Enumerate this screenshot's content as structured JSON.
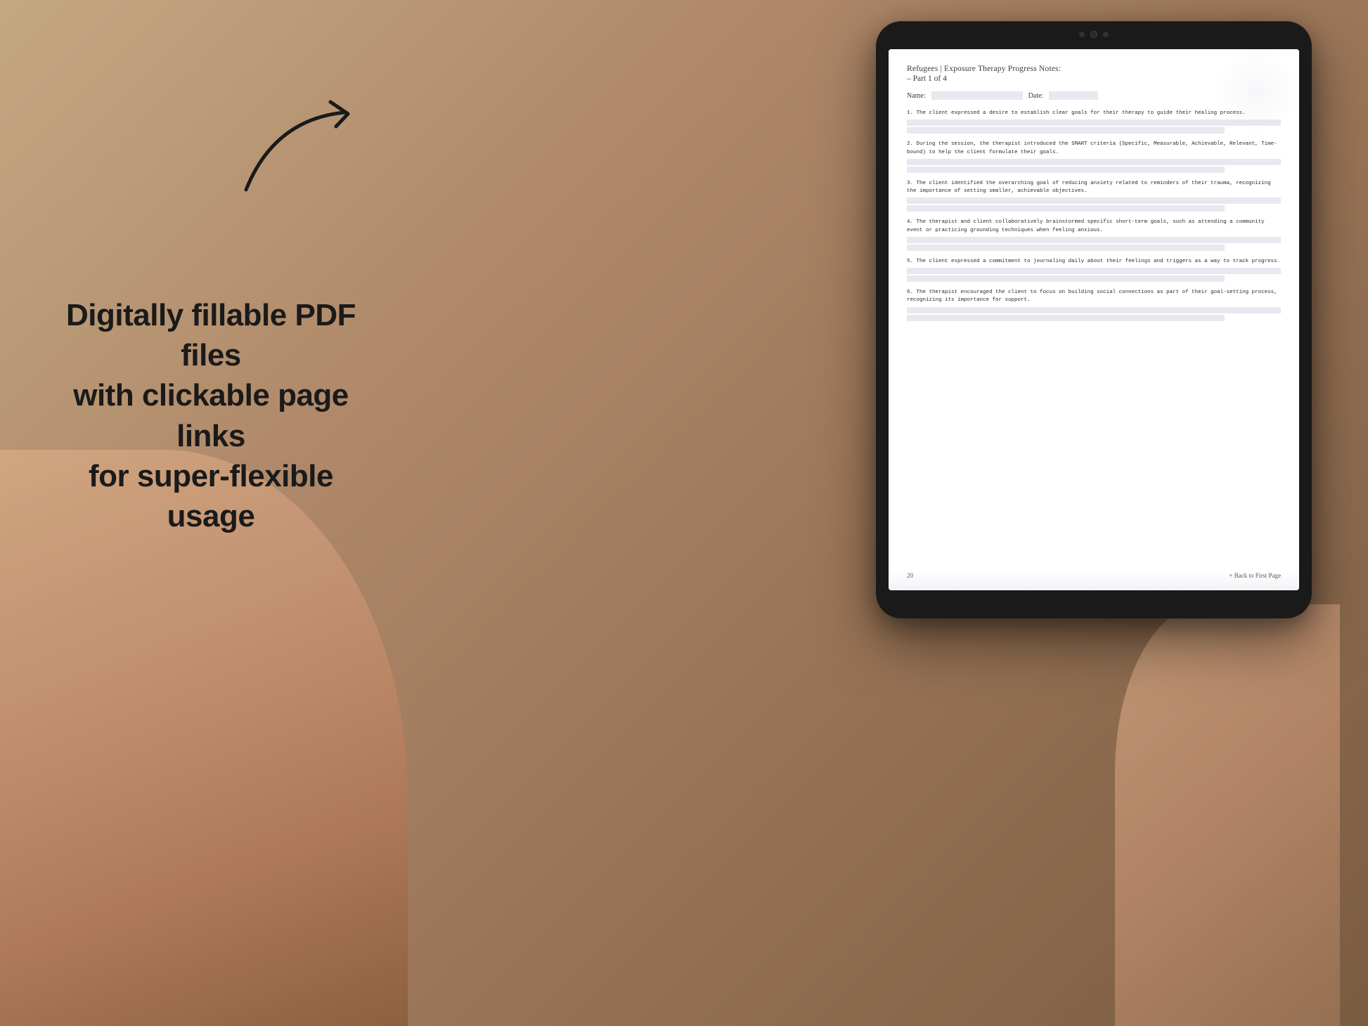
{
  "background": {
    "color": "#b5967a"
  },
  "left_text": {
    "line1": "Digitally fillable PDF files",
    "line2": "with clickable page links",
    "line3": "for super-flexible usage"
  },
  "arrow": {
    "description": "curved arrow pointing right toward tablet"
  },
  "tablet": {
    "title": "Refugees | Exposure Therapy Progress Notes:",
    "subtitle": "– Part 1 of 4",
    "fields": {
      "name_label": "Name:",
      "date_label": "Date:"
    },
    "items": [
      {
        "number": "1.",
        "text": "The client expressed a desire to establish clear goals for their therapy to guide their\nhealing process."
      },
      {
        "number": "2.",
        "text": "During the session, the therapist introduced the SMART criteria (Specific, Measurable,\nAchievable, Relevant, Time-bound) to help the client formulate their goals."
      },
      {
        "number": "3.",
        "text": "The client identified the overarching goal of reducing anxiety related to reminders of\ntheir trauma, recognizing the importance of setting smaller, achievable objectives."
      },
      {
        "number": "4.",
        "text": "The therapist and client collaboratively brainstormed specific short-term goals, such as\nattending a community event or practicing grounding techniques when feeling anxious."
      },
      {
        "number": "5.",
        "text": "The client expressed a commitment to journaling daily about their feelings and triggers as\na way to track progress."
      },
      {
        "number": "6.",
        "text": "The therapist encouraged the client to focus on building social connections as part of\ntheir goal-setting process, recognizing its importance for support."
      }
    ],
    "footer": {
      "page_number": "20",
      "back_link": "+ Back to First Page"
    }
  }
}
